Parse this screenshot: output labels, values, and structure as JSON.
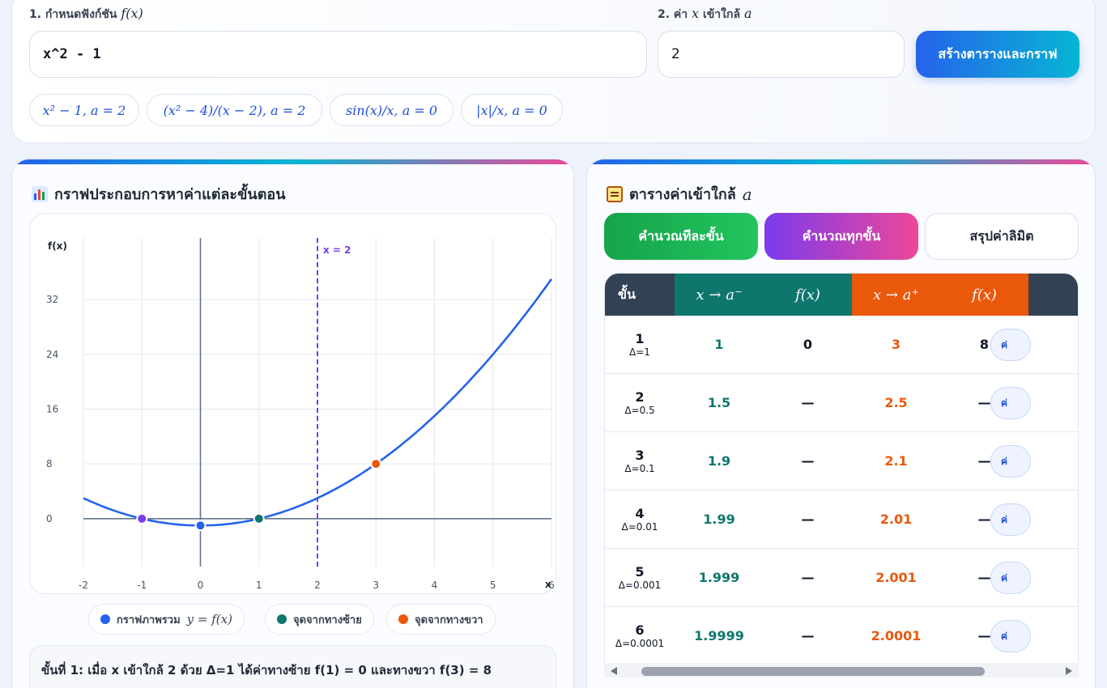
{
  "input": {
    "fx_label": "1. กำหนดฟังก์ชัน",
    "fx_symbol": "f(x)",
    "fx_value": "x^2 - 1",
    "a_label_pre": "2. ค่า",
    "a_label_x": "x",
    "a_label_mid": "เข้าใกล้",
    "a_label_a": "a",
    "a_value": "2",
    "generate_button": "สร้างตารางและกราฟ",
    "examples": [
      "x² − 1, a = 2",
      "(x² − 4)/(x − 2), a = 2",
      "sin(x)/x, a = 0",
      "|x|/x, a = 0"
    ]
  },
  "graph_panel": {
    "title": "กราฟประกอบการหาค่าแต่ละขั้นตอน",
    "icon": "bar-chart-icon",
    "legend": [
      {
        "label": "กราฟภาพรวม",
        "math": "y = f(x)",
        "color": "#2563eb"
      },
      {
        "label": "จุดจากทางซ้าย",
        "color": "#0f766e"
      },
      {
        "label": "จุดจากทางขวา",
        "color": "#ea580c"
      }
    ],
    "step_note": "ขั้นที่ 1: เมื่อ x เข้าใกล้ 2 ด้วย Δ=1 ได้ค่าทางซ้าย f(1) = 0 และทางขวา f(3) = 8"
  },
  "chart_data": {
    "type": "line",
    "function": "x^2 - 1",
    "ylabel": "f(x)",
    "xlabel": "x",
    "x_ticks": [
      "-2",
      "-1",
      "0",
      "1",
      "2",
      "3",
      "4",
      "5",
      "6"
    ],
    "y_ticks": [
      "0",
      "8",
      "16",
      "24",
      "32"
    ],
    "xlim": [
      -2,
      6
    ],
    "ylim": [
      -7,
      41
    ],
    "grid": true,
    "vline": {
      "x": 2,
      "label": "x = 2",
      "color": "#7c3aed"
    },
    "points": [
      {
        "x": -1,
        "y": 0,
        "color": "#7c3aed"
      },
      {
        "x": 0,
        "y": -1,
        "color": "#2563eb"
      },
      {
        "x": 1,
        "y": 0,
        "color": "#0f766e"
      },
      {
        "x": 3,
        "y": 8,
        "color": "#ea580c"
      }
    ],
    "curve_color": "#2563eb"
  },
  "table_panel": {
    "title": "ตารางค่าเข้าใกล้",
    "title_math": "a",
    "icon": "clipboard-icon",
    "tabs": [
      "คำนวณทีละขั้น",
      "คำนวณทุกขั้น",
      "สรุปค่าลิมิต"
    ],
    "headers": {
      "step": "ขั้น",
      "left_x": "x → a⁻",
      "left_f": "f(x)",
      "right_x": "x → a⁺",
      "right_f": "f(x)"
    },
    "rows": [
      {
        "n": "1",
        "delta": "Δ=1",
        "lx": "1",
        "lf": "0",
        "rx": "3",
        "rf": "8",
        "act": "ค่"
      },
      {
        "n": "2",
        "delta": "Δ=0.5",
        "lx": "1.5",
        "lf": "—",
        "rx": "2.5",
        "rf": "—",
        "act": "ค่"
      },
      {
        "n": "3",
        "delta": "Δ=0.1",
        "lx": "1.9",
        "lf": "—",
        "rx": "2.1",
        "rf": "—",
        "act": "ค่"
      },
      {
        "n": "4",
        "delta": "Δ=0.01",
        "lx": "1.99",
        "lf": "—",
        "rx": "2.01",
        "rf": "—",
        "act": "ค่"
      },
      {
        "n": "5",
        "delta": "Δ=0.001",
        "lx": "1.999",
        "lf": "—",
        "rx": "2.001",
        "rf": "—",
        "act": "ค่"
      },
      {
        "n": "6",
        "delta": "Δ=0.0001",
        "lx": "1.9999",
        "lf": "—",
        "rx": "2.0001",
        "rf": "—",
        "act": "ค่"
      }
    ]
  }
}
